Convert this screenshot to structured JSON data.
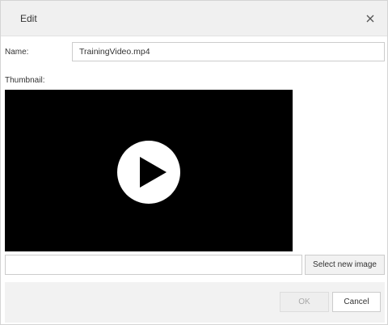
{
  "dialog": {
    "title": "Edit",
    "close_icon": "close-icon"
  },
  "form": {
    "name_label": "Name:",
    "name_value": "TrainingVideo.mp4",
    "thumbnail_label": "Thumbnail:",
    "thumbnail_path_value": "",
    "select_image_label": "Select new image",
    "play_icon": "play-icon"
  },
  "footer": {
    "ok_label": "OK",
    "ok_disabled": true,
    "cancel_label": "Cancel"
  }
}
